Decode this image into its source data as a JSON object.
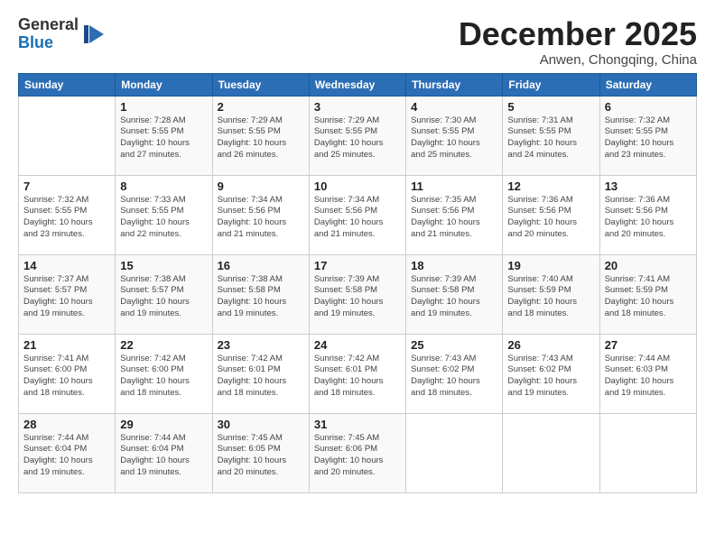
{
  "logo": {
    "general": "General",
    "blue": "Blue"
  },
  "header": {
    "month": "December 2025",
    "location": "Anwen, Chongqing, China"
  },
  "weekdays": [
    "Sunday",
    "Monday",
    "Tuesday",
    "Wednesday",
    "Thursday",
    "Friday",
    "Saturday"
  ],
  "weeks": [
    [
      {
        "day": "",
        "info": ""
      },
      {
        "day": "1",
        "info": "Sunrise: 7:28 AM\nSunset: 5:55 PM\nDaylight: 10 hours\nand 27 minutes."
      },
      {
        "day": "2",
        "info": "Sunrise: 7:29 AM\nSunset: 5:55 PM\nDaylight: 10 hours\nand 26 minutes."
      },
      {
        "day": "3",
        "info": "Sunrise: 7:29 AM\nSunset: 5:55 PM\nDaylight: 10 hours\nand 25 minutes."
      },
      {
        "day": "4",
        "info": "Sunrise: 7:30 AM\nSunset: 5:55 PM\nDaylight: 10 hours\nand 25 minutes."
      },
      {
        "day": "5",
        "info": "Sunrise: 7:31 AM\nSunset: 5:55 PM\nDaylight: 10 hours\nand 24 minutes."
      },
      {
        "day": "6",
        "info": "Sunrise: 7:32 AM\nSunset: 5:55 PM\nDaylight: 10 hours\nand 23 minutes."
      }
    ],
    [
      {
        "day": "7",
        "info": "Sunrise: 7:32 AM\nSunset: 5:55 PM\nDaylight: 10 hours\nand 23 minutes."
      },
      {
        "day": "8",
        "info": "Sunrise: 7:33 AM\nSunset: 5:55 PM\nDaylight: 10 hours\nand 22 minutes."
      },
      {
        "day": "9",
        "info": "Sunrise: 7:34 AM\nSunset: 5:56 PM\nDaylight: 10 hours\nand 21 minutes."
      },
      {
        "day": "10",
        "info": "Sunrise: 7:34 AM\nSunset: 5:56 PM\nDaylight: 10 hours\nand 21 minutes."
      },
      {
        "day": "11",
        "info": "Sunrise: 7:35 AM\nSunset: 5:56 PM\nDaylight: 10 hours\nand 21 minutes."
      },
      {
        "day": "12",
        "info": "Sunrise: 7:36 AM\nSunset: 5:56 PM\nDaylight: 10 hours\nand 20 minutes."
      },
      {
        "day": "13",
        "info": "Sunrise: 7:36 AM\nSunset: 5:56 PM\nDaylight: 10 hours\nand 20 minutes."
      }
    ],
    [
      {
        "day": "14",
        "info": "Sunrise: 7:37 AM\nSunset: 5:57 PM\nDaylight: 10 hours\nand 19 minutes."
      },
      {
        "day": "15",
        "info": "Sunrise: 7:38 AM\nSunset: 5:57 PM\nDaylight: 10 hours\nand 19 minutes."
      },
      {
        "day": "16",
        "info": "Sunrise: 7:38 AM\nSunset: 5:58 PM\nDaylight: 10 hours\nand 19 minutes."
      },
      {
        "day": "17",
        "info": "Sunrise: 7:39 AM\nSunset: 5:58 PM\nDaylight: 10 hours\nand 19 minutes."
      },
      {
        "day": "18",
        "info": "Sunrise: 7:39 AM\nSunset: 5:58 PM\nDaylight: 10 hours\nand 19 minutes."
      },
      {
        "day": "19",
        "info": "Sunrise: 7:40 AM\nSunset: 5:59 PM\nDaylight: 10 hours\nand 18 minutes."
      },
      {
        "day": "20",
        "info": "Sunrise: 7:41 AM\nSunset: 5:59 PM\nDaylight: 10 hours\nand 18 minutes."
      }
    ],
    [
      {
        "day": "21",
        "info": "Sunrise: 7:41 AM\nSunset: 6:00 PM\nDaylight: 10 hours\nand 18 minutes."
      },
      {
        "day": "22",
        "info": "Sunrise: 7:42 AM\nSunset: 6:00 PM\nDaylight: 10 hours\nand 18 minutes."
      },
      {
        "day": "23",
        "info": "Sunrise: 7:42 AM\nSunset: 6:01 PM\nDaylight: 10 hours\nand 18 minutes."
      },
      {
        "day": "24",
        "info": "Sunrise: 7:42 AM\nSunset: 6:01 PM\nDaylight: 10 hours\nand 18 minutes."
      },
      {
        "day": "25",
        "info": "Sunrise: 7:43 AM\nSunset: 6:02 PM\nDaylight: 10 hours\nand 18 minutes."
      },
      {
        "day": "26",
        "info": "Sunrise: 7:43 AM\nSunset: 6:02 PM\nDaylight: 10 hours\nand 19 minutes."
      },
      {
        "day": "27",
        "info": "Sunrise: 7:44 AM\nSunset: 6:03 PM\nDaylight: 10 hours\nand 19 minutes."
      }
    ],
    [
      {
        "day": "28",
        "info": "Sunrise: 7:44 AM\nSunset: 6:04 PM\nDaylight: 10 hours\nand 19 minutes."
      },
      {
        "day": "29",
        "info": "Sunrise: 7:44 AM\nSunset: 6:04 PM\nDaylight: 10 hours\nand 19 minutes."
      },
      {
        "day": "30",
        "info": "Sunrise: 7:45 AM\nSunset: 6:05 PM\nDaylight: 10 hours\nand 20 minutes."
      },
      {
        "day": "31",
        "info": "Sunrise: 7:45 AM\nSunset: 6:06 PM\nDaylight: 10 hours\nand 20 minutes."
      },
      {
        "day": "",
        "info": ""
      },
      {
        "day": "",
        "info": ""
      },
      {
        "day": "",
        "info": ""
      }
    ]
  ]
}
